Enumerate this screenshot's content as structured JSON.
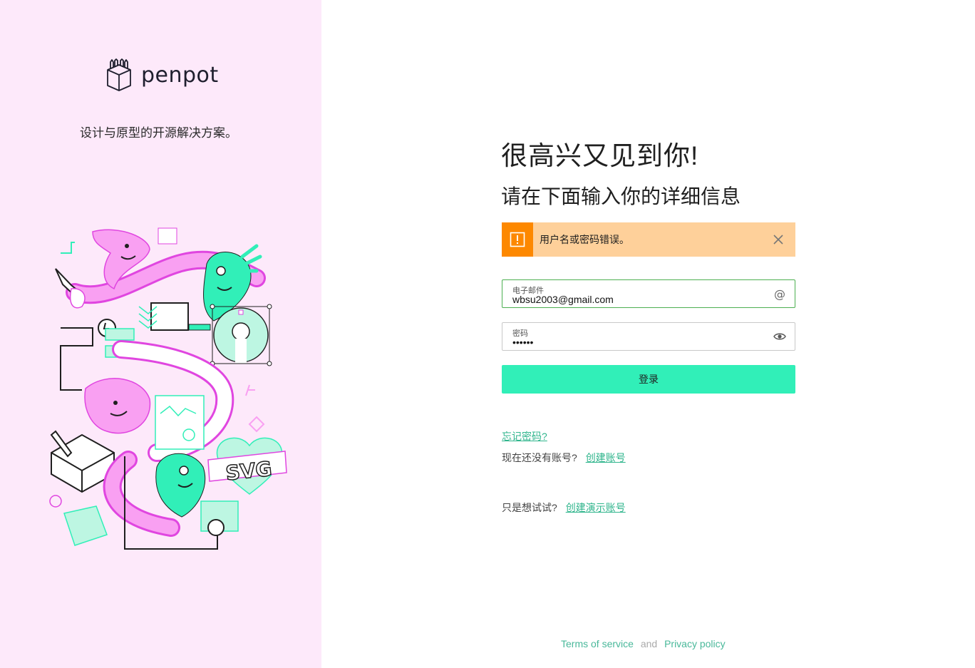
{
  "brand": {
    "name": "penpot",
    "tagline": "设计与原型的开源解决方案。"
  },
  "illustration": {
    "badge_text": "SVG"
  },
  "login": {
    "heading": "很高兴又见到你!",
    "subheading": "请在下面输入你的详细信息",
    "alert": {
      "message": "用户名或密码错误。",
      "type": "warning"
    },
    "email": {
      "label": "电子邮件",
      "value": "wbsu2003@gmail.com"
    },
    "password": {
      "label": "密码",
      "value": "••••••"
    },
    "submit_label": "登录",
    "forgot_password": "忘记密码?",
    "no_account": "现在还没有账号?",
    "create_account": "创建账号",
    "just_try": "只是想试试?",
    "create_demo": "创建演示账号"
  },
  "footer": {
    "terms": "Terms of service",
    "and": "and",
    "privacy": "Privacy policy"
  },
  "colors": {
    "sidebar_bg": "#fde9fa",
    "accent": "#31efb8",
    "link": "#2fb58c",
    "alert_bg": "#fed09a",
    "alert_icon_bg": "#fd8800",
    "illustration_pink": "#f9a0f2",
    "illustration_magenta": "#e046e0",
    "illustration_green": "#31efb8"
  }
}
